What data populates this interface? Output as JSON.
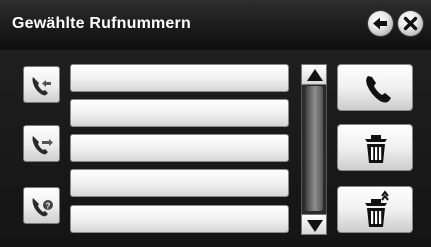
{
  "header": {
    "title": "Gewählte Rufnummern",
    "back_icon": "back-arrow-icon",
    "close_icon": "close-icon"
  },
  "filters": [
    {
      "icon": "incoming-call-icon"
    },
    {
      "icon": "outgoing-call-icon"
    },
    {
      "icon": "missed-call-icon"
    }
  ],
  "list": {
    "rows": [
      "",
      "",
      "",
      "",
      ""
    ]
  },
  "scrollbar": {
    "up_icon": "scroll-up-icon",
    "down_icon": "scroll-down-icon"
  },
  "actions": [
    {
      "icon": "call-icon"
    },
    {
      "icon": "delete-icon"
    },
    {
      "icon": "delete-all-icon"
    }
  ]
}
